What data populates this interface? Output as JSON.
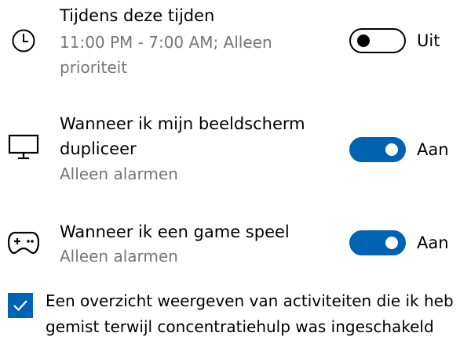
{
  "rules": [
    {
      "icon": "clock-icon",
      "title": "Tijdens deze tijden",
      "description": "11:00 PM - 7:00 AM; Alleen prioriteit",
      "toggle_on": false,
      "state_label": "Uit"
    },
    {
      "icon": "monitor-icon",
      "title": "Wanneer ik mijn beeldscherm dupliceer",
      "description": "Alleen alarmen",
      "toggle_on": true,
      "state_label": "Aan"
    },
    {
      "icon": "gamepad-icon",
      "title": "Wanneer ik een game speel",
      "description": "Alleen alarmen",
      "toggle_on": true,
      "state_label": "Aan"
    }
  ],
  "summary_checkbox": {
    "checked": true,
    "label": "Een overzicht weergeven van activiteiten die ik heb gemist terwijl concentratiehulp was ingeschakeld"
  },
  "colors": {
    "accent": "#0063b1",
    "secondary_text": "#767676"
  }
}
